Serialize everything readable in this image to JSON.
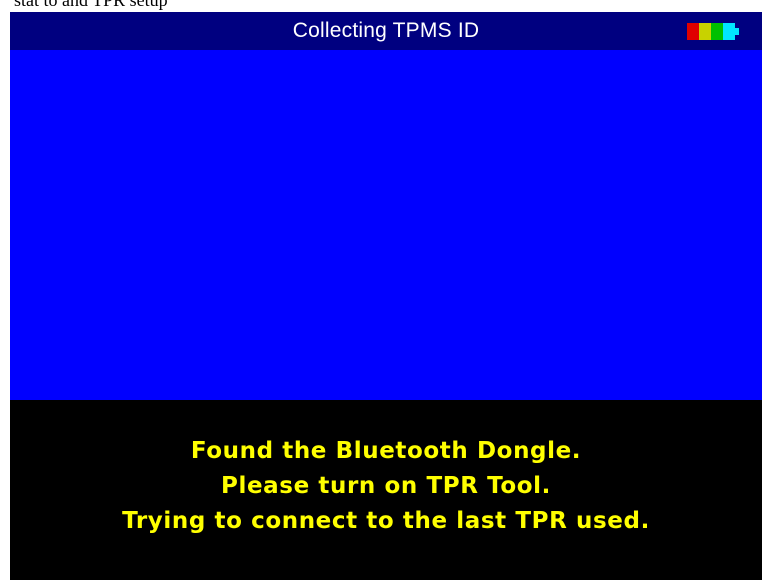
{
  "window": {
    "partial_top_text": "stat to and TPR setup"
  },
  "header": {
    "title": "Collecting TPMS ID",
    "battery": {
      "icon": "battery-icon",
      "segments": [
        {
          "name": "red",
          "color": "#e00000"
        },
        {
          "name": "yellow",
          "color": "#c8d200"
        },
        {
          "name": "green",
          "color": "#00c000"
        },
        {
          "name": "cyan",
          "color": "#00e6ff"
        }
      ]
    }
  },
  "main": {
    "background_color": "#0000ff"
  },
  "status": {
    "lines": [
      "Found the Bluetooth Dongle.",
      "Please turn on TPR Tool.",
      "Trying to connect to the last TPR used."
    ],
    "text_color": "#ffff00"
  },
  "colors": {
    "title_bar": "#000080",
    "panel": "#000000"
  }
}
